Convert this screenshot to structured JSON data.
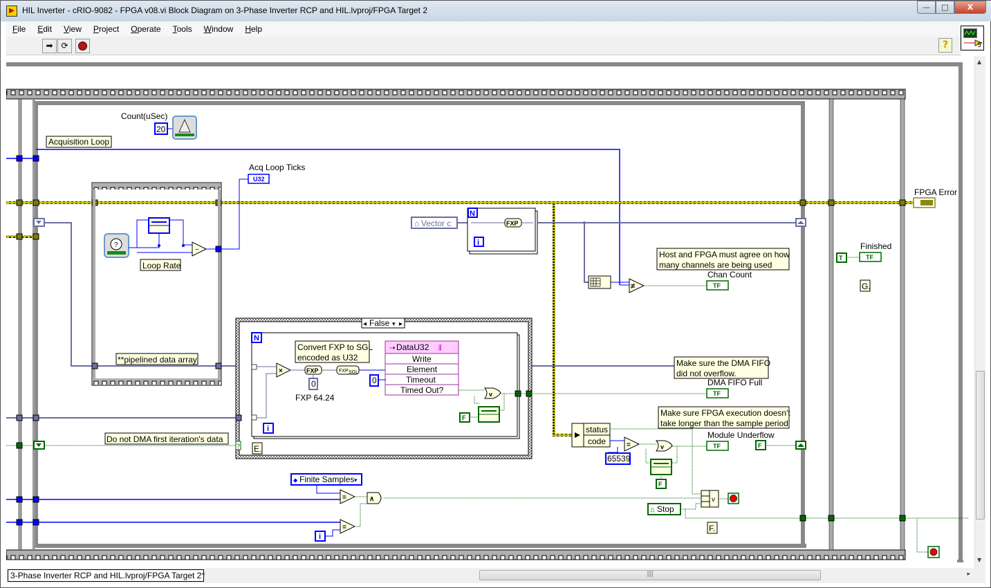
{
  "window": {
    "title": "HIL Inverter - cRIO-9082 - FPGA v08.vi Block Diagram on 3-Phase Inverter RCP and HIL.lvproj/FPGA Target 2",
    "controls": {
      "minimize": "—",
      "maximize": "□",
      "close": "X"
    }
  },
  "menu": [
    "File",
    "Edit",
    "View",
    "Project",
    "Operate",
    "Tools",
    "Window",
    "Help"
  ],
  "toolbar": {
    "run_icon": "run-arrow-icon",
    "run_continuous_icon": "run-continuously-icon",
    "abort_icon": "abort-icon",
    "help_label": "?"
  },
  "vi_icon": {
    "connector_number": "5"
  },
  "diagram": {
    "count_label": "Count(uSec)",
    "count_value": "20",
    "acquisition_loop_label": "Acquisition Loop",
    "acq_loop_ticks_label": "Acq Loop Ticks",
    "acq_loop_ticks_type": "U32",
    "loop_rate_label": "Loop Rate",
    "pipelined_label": "**pipelined data array",
    "vector_control": "Vector c",
    "fxp_label": "FXP",
    "case_selector": "False",
    "convert_comment": [
      "Convert FXP to SGL",
      "encoded as U32"
    ],
    "fxp_const": "0",
    "fxp_const_label": "FXP 64.24",
    "fxp_to_sgl_label": "FXP SGL",
    "fifo_node": {
      "title": "DataU32",
      "method": "Write",
      "inputs": [
        "Element",
        "Timeout"
      ],
      "output": "Timed Out?"
    },
    "timeout_const": "0",
    "false_const": "F",
    "true_const": "T",
    "do_not_dma_comment": "Do not DMA first iteration's data",
    "iteration_terminal": "i",
    "count_terminal": "N",
    "host_fpga_comment": [
      "Host and FPGA must agree on how",
      "many channels are being used"
    ],
    "chan_count_label": "Chan Count",
    "dma_comment": [
      "Make sure the DMA FIFO",
      "did not overflow."
    ],
    "dma_fifo_full_label": "DMA FIFO Full",
    "fpga_exec_comment": [
      "Make sure FPGA execution doesn't",
      "take longer than the sample period"
    ],
    "module_underflow_label": "Module Underflow",
    "status_label": "status",
    "code_label": "code",
    "code_const": "65539",
    "finite_samples": "Finite Samples",
    "stop_control": "Stop",
    "fpga_error_label": "FPGA Error",
    "finished_label": "Finished",
    "bool_indicator": "TF",
    "frame_labels": {
      "e": "E.",
      "f": "F.",
      "g": "G."
    }
  },
  "status_bar": {
    "context": "3-Phase Inverter RCP and HIL.lvproj/FPGA Target 2"
  },
  "colors": {
    "int_wire": "#0000ff",
    "fxp_wire": "#6a6ea0",
    "bool_wire": "#006600",
    "error_wire": "#c8c800",
    "comment_bg": "#ffffe1",
    "structure_gray": "#888888"
  }
}
